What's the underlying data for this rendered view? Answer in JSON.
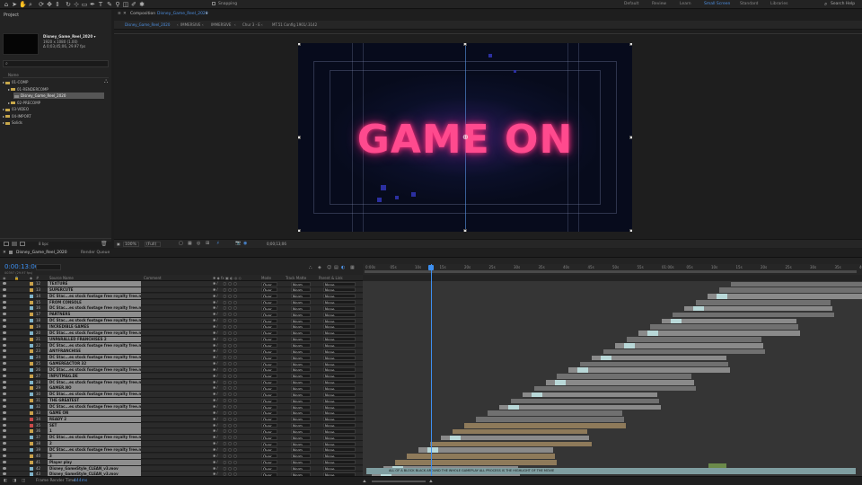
{
  "toolbar": {
    "snapping_label": "Snapping",
    "workspaces": [
      "Default",
      "Review",
      "Learn",
      "Small Screen",
      "Standard",
      "Libraries"
    ],
    "active_workspace": "Small Screen",
    "search_help": "Search Help"
  },
  "project": {
    "panel_title": "Project",
    "comp_name": "Disney_Game_Reel_2020 ▾",
    "info_line1": "1920 x 1080 (1.00)",
    "info_line2": "Δ 0;03;45;06, 29.97 fps",
    "name_header": "Name",
    "tree": [
      {
        "label": "01-COMP",
        "level": 0,
        "selected": false
      },
      {
        "label": "01-RENDERCOMP",
        "level": 1,
        "selected": false
      },
      {
        "label": "Disney_Game_Reel_2020",
        "level": 2,
        "selected": true
      },
      {
        "label": "02-PRECOMP",
        "level": 1,
        "selected": false
      },
      {
        "label": "03-VIDEO",
        "level": 0,
        "selected": false
      },
      {
        "label": "04-IMPORT",
        "level": 0,
        "selected": false
      },
      {
        "label": "Solids",
        "level": 0,
        "selected": false
      }
    ],
    "footer_bpc": "8 bpc"
  },
  "composition": {
    "tab_label": "Composition",
    "tab_comp": "Disney_Game_Reel_2020",
    "breadcrumbs": [
      "Disney_Game_Reel_2020",
      "IMMERSIVE",
      "IMMERSIVE",
      "Chur 3 - E",
      "MT.51 Config 1901/.3142"
    ],
    "title_text": "GAME ON",
    "zoom": "100%",
    "resolution": "(Full)",
    "timecode": "0;00;13;06"
  },
  "timeline": {
    "tab_label": "Disney_Game_Reel_2020",
    "render_queue": "Render Queue",
    "timecode": "0:00:13:06",
    "fps_label": "00397 (29.97 fps)",
    "headers": {
      "source": "Source Name",
      "comment": "Comment",
      "mode": "Mode",
      "trkmat": "Track Matte",
      "parent": "Parent & Link"
    },
    "ruler_ticks": [
      "0:00s",
      "05s",
      "10s",
      "15s",
      "20s",
      "25s",
      "30s",
      "35s",
      "40s",
      "45s",
      "50s",
      "55s",
      "01:00s",
      "05s",
      "10s",
      "15s",
      "20s",
      "25s",
      "30s",
      "35s",
      "40s"
    ],
    "footer_label": "Frame Render Time",
    "footer_value": "444ms",
    "audio_label": "ALL OF A BLOCK BLACK AROUND THE WHOLE GAMEPLAY ALL PROCESS IS THE HIGHLIGHT OF THE MOVIE"
  },
  "layers": [
    {
      "num": "12",
      "name": "TEXTURE",
      "color": "#c9a14a"
    },
    {
      "num": "13",
      "name": "SUPERCUTE",
      "color": "#c9a14a"
    },
    {
      "num": "14",
      "name": "DC Stac...es stock footage free royalty free.mp4",
      "color": "#7fb3c9"
    },
    {
      "num": "15",
      "name": "FROM CONSOLE",
      "color": "#c9a14a"
    },
    {
      "num": "16",
      "name": "DC Stac...es stock footage free royalty free.mp4",
      "color": "#7fb3c9"
    },
    {
      "num": "17",
      "name": "PARTNERS",
      "color": "#c9a14a"
    },
    {
      "num": "18",
      "name": "DC Stac...es stock footage free royalty free.mp4",
      "color": "#7fb3c9"
    },
    {
      "num": "19",
      "name": "INCREDIBLE GAMES",
      "color": "#c9a14a"
    },
    {
      "num": "20",
      "name": "DC Stac...es stock footage free royalty free.mp4",
      "color": "#7fb3c9"
    },
    {
      "num": "21",
      "name": "UNPARALLED FRANCHISES 2",
      "color": "#c9a14a"
    },
    {
      "num": "22",
      "name": "DC Stac...es stock footage free royalty free.mp4",
      "color": "#7fb3c9"
    },
    {
      "num": "23",
      "name": "ANYFRANCHISE",
      "color": "#c9a14a"
    },
    {
      "num": "24",
      "name": "DC Stac...es stock footage free royalty free.mp4",
      "color": "#7fb3c9"
    },
    {
      "num": "25",
      "name": "GAMEREACTOR 32",
      "color": "#c9a14a"
    },
    {
      "num": "26",
      "name": "DC Stac...es stock footage free royalty free.mp4",
      "color": "#7fb3c9"
    },
    {
      "num": "27",
      "name": "INPUTMAG.DE",
      "color": "#c9a14a"
    },
    {
      "num": "28",
      "name": "DC Stac...es stock footage free royalty free.mp4",
      "color": "#7fb3c9"
    },
    {
      "num": "29",
      "name": "GAMER.NO",
      "color": "#c9a14a"
    },
    {
      "num": "30",
      "name": "DC Stac...es stock footage free royalty free.mp4",
      "color": "#7fb3c9"
    },
    {
      "num": "31",
      "name": "THE GREATEST",
      "color": "#c9a14a"
    },
    {
      "num": "32",
      "name": "DC Stac...es stock footage free royalty free.mp4",
      "color": "#7fb3c9"
    },
    {
      "num": "33",
      "name": "GAME ON",
      "color": "#c9a14a"
    },
    {
      "num": "34",
      "name": "READY 2",
      "color": "#c94a4a"
    },
    {
      "num": "35",
      "name": "SET",
      "color": "#c94a4a"
    },
    {
      "num": "36",
      "name": "1",
      "color": "#c9a14a"
    },
    {
      "num": "37",
      "name": "DC Stac...es stock footage free royalty free.mp4",
      "color": "#7fb3c9"
    },
    {
      "num": "38",
      "name": "2",
      "color": "#c9a14a"
    },
    {
      "num": "39",
      "name": "DC Stac...es stock footage free royalty free.mp4",
      "color": "#7fb3c9"
    },
    {
      "num": "40",
      "name": "3",
      "color": "#c9a14a"
    },
    {
      "num": "41",
      "name": "Player play",
      "color": "#c9a14a"
    },
    {
      "num": "42",
      "name": "Disney_GameStyle_CLEAN_v3.mov",
      "color": "#7fb3c9"
    },
    {
      "num": "43",
      "name": "Disney_GameStyle_CLEAN_v3.mov",
      "color": "#7fb3c9"
    }
  ],
  "layer_defaults": {
    "mode": "Over",
    "trkmat": "Norm",
    "parent": "None"
  },
  "colors": {
    "accent": "#3d8ff0",
    "title_pink": "#ff4a8e",
    "folder": "#c8a84a"
  }
}
